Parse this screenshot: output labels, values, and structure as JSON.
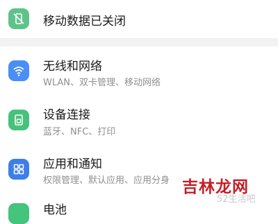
{
  "top_item": {
    "label": "移动数据已关闭",
    "icon": "mobile-data-off-icon",
    "color": "#5ec38a"
  },
  "items": [
    {
      "title": "无线和网络",
      "subtitle": "WLAN、双卡管理、移动网络",
      "icon": "wifi-icon",
      "color": "#4a8ff5"
    },
    {
      "title": "设备连接",
      "subtitle": "蓝牙、NFC、打印",
      "icon": "device-connection-icon",
      "color": "#47c27a"
    },
    {
      "title": "应用和通知",
      "subtitle": "权限管理、默认应用、应用分身",
      "icon": "apps-icon",
      "color": "#3d7fe8"
    }
  ],
  "partial_item": {
    "title": "电池",
    "color": "#44c47c"
  },
  "watermark": {
    "brand": "吉林龙网",
    "url": "52生活吧"
  }
}
